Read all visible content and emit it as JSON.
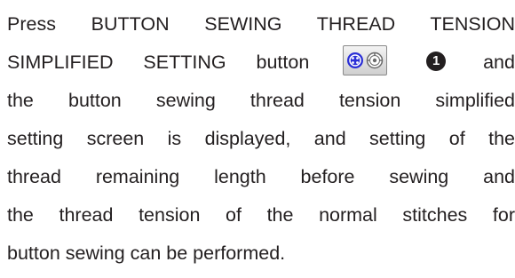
{
  "paragraph": {
    "line1": "Press BUTTON SEWING THREAD TENSION",
    "line2_before": "SIMPLIFIED SETTING button",
    "line2_after": "and",
    "line3": "the button sewing thread tension simplified",
    "line4": "setting screen is displayed, and setting of the",
    "line5": "thread remaining length before sewing and",
    "line6": "the thread tension of the normal stitches for",
    "line7": "button sewing can be performed."
  },
  "inline_button": {
    "icon_left": "button-icon",
    "icon_right": "thread-tension-dial-icon",
    "accent_color": "#2b2fd6",
    "bg_color": "#dcdcdc"
  },
  "callout": {
    "number": "1",
    "glyph": "❶"
  }
}
